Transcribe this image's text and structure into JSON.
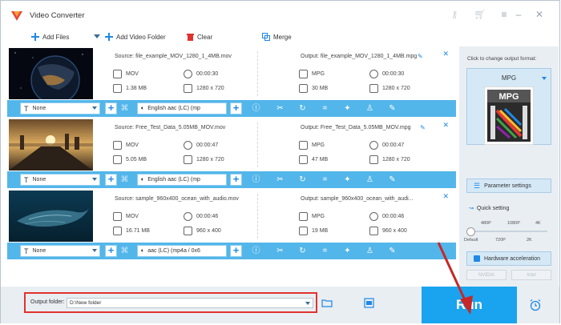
{
  "app": {
    "title": "Video Converter"
  },
  "toolbar": {
    "add_files": "Add Files",
    "add_video_folder": "Add Video Folder",
    "clear": "Clear",
    "merge": "Merge"
  },
  "files": [
    {
      "source": "Source: file_example_MOV_1280_1_4MB.mov",
      "output": "Output: file_example_MOV_1280_1_4MB.mpg",
      "src_format": "MOV",
      "src_duration": "00:00:30",
      "src_size": "1.38 MB",
      "src_res": "1280 x 720",
      "out_format": "MPG",
      "out_duration": "00:00:30",
      "out_size": "30 MB",
      "out_res": "1280 x 720",
      "subtitle": "None",
      "audio": "English aac (LC) (mp"
    },
    {
      "source": "Source: Free_Test_Data_5.05MB_MOV.mov",
      "output": "Output: Free_Test_Data_5.05MB_MOV.mpg",
      "src_format": "MOV",
      "src_duration": "00:00:47",
      "src_size": "5.05 MB",
      "src_res": "1280 x 720",
      "out_format": "MPG",
      "out_duration": "00:00:47",
      "out_size": "47 MB",
      "out_res": "1280 x 720",
      "subtitle": "None",
      "audio": "English aac (LC) (mp"
    },
    {
      "source": "Source: sample_960x400_ocean_with_audio.mov",
      "output": "Output: sample_960x400_ocean_with_audi...",
      "src_format": "MOV",
      "src_duration": "00:00:46",
      "src_size": "16.71 MB",
      "src_res": "960 x 400",
      "out_format": "MPG",
      "out_duration": "00:00:46",
      "out_size": "19 MB",
      "out_res": "960 x 400",
      "subtitle": "None",
      "audio": "aac (LC) (mp4a / 0x6"
    }
  ],
  "panel": {
    "hint": "Click to change output format:",
    "format": "MPG",
    "format_icon_text": "MPG",
    "param_settings": "Parameter settings",
    "quick_setting": "Quick setting",
    "ticks_top": [
      "480P",
      "1080P",
      "4K"
    ],
    "ticks_bottom": [
      "Default",
      "720P",
      "2K"
    ],
    "quality_level": 0,
    "hw_accel": "Hardware acceleration",
    "nvidia": "NVIDIA",
    "intel": "Intel"
  },
  "bottom": {
    "output_folder_label": "Output folder:",
    "output_folder_value": "D:\\New folder",
    "run": "Run"
  },
  "colors": {
    "accent": "#1aa3ef",
    "bar": "#53b6ea",
    "highlight": "#e0332e"
  }
}
